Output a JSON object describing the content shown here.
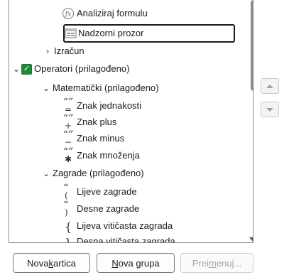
{
  "tree": {
    "items": [
      {
        "label": "Analiziraj formulu",
        "icon": "fx-icon"
      },
      {
        "label": "Nadzorni prozor",
        "icon": "watch-window-icon"
      },
      {
        "label": "Izračun",
        "icon": "chevron-right-icon"
      },
      {
        "label": "Operatori (prilagođeno)",
        "icon": "checkbox-icon",
        "checked": true
      },
      {
        "label": "Matematički (prilagođeno)",
        "icon": "chevron-down-icon"
      },
      {
        "label": "Znak jednakosti",
        "icon": "equals-sign-icon",
        "glyph": "="
      },
      {
        "label": "Znak plus",
        "icon": "plus-sign-icon",
        "glyph": "+"
      },
      {
        "label": "Znak minus",
        "icon": "minus-sign-icon",
        "glyph": "−"
      },
      {
        "label": "Znak množenja",
        "icon": "multiply-sign-icon",
        "glyph": "✱"
      },
      {
        "label": "Zagrade (prilagođeno)",
        "icon": "chevron-down-icon"
      },
      {
        "label": "Lijeve zagrade",
        "icon": "left-paren-icon",
        "glyph": "("
      },
      {
        "label": "Desne zagrade",
        "icon": "right-paren-icon",
        "glyph": ")"
      },
      {
        "label": "Lijeva vitičasta zagrada",
        "icon": "left-brace-icon",
        "glyph": "{"
      },
      {
        "label": "Desna vitičasta zagrada",
        "icon": "right-brace-icon",
        "glyph": "}"
      }
    ]
  },
  "buttons": {
    "new_tab": {
      "before": "Nova ",
      "underline": "k",
      "after": "artica"
    },
    "new_group": {
      "before": "",
      "underline": "N",
      "after": "ova grupa"
    },
    "rename": {
      "before": "Prei",
      "underline": "m",
      "after": "enuj..."
    }
  },
  "colors": {
    "accent_check": "#1f8a3a"
  }
}
